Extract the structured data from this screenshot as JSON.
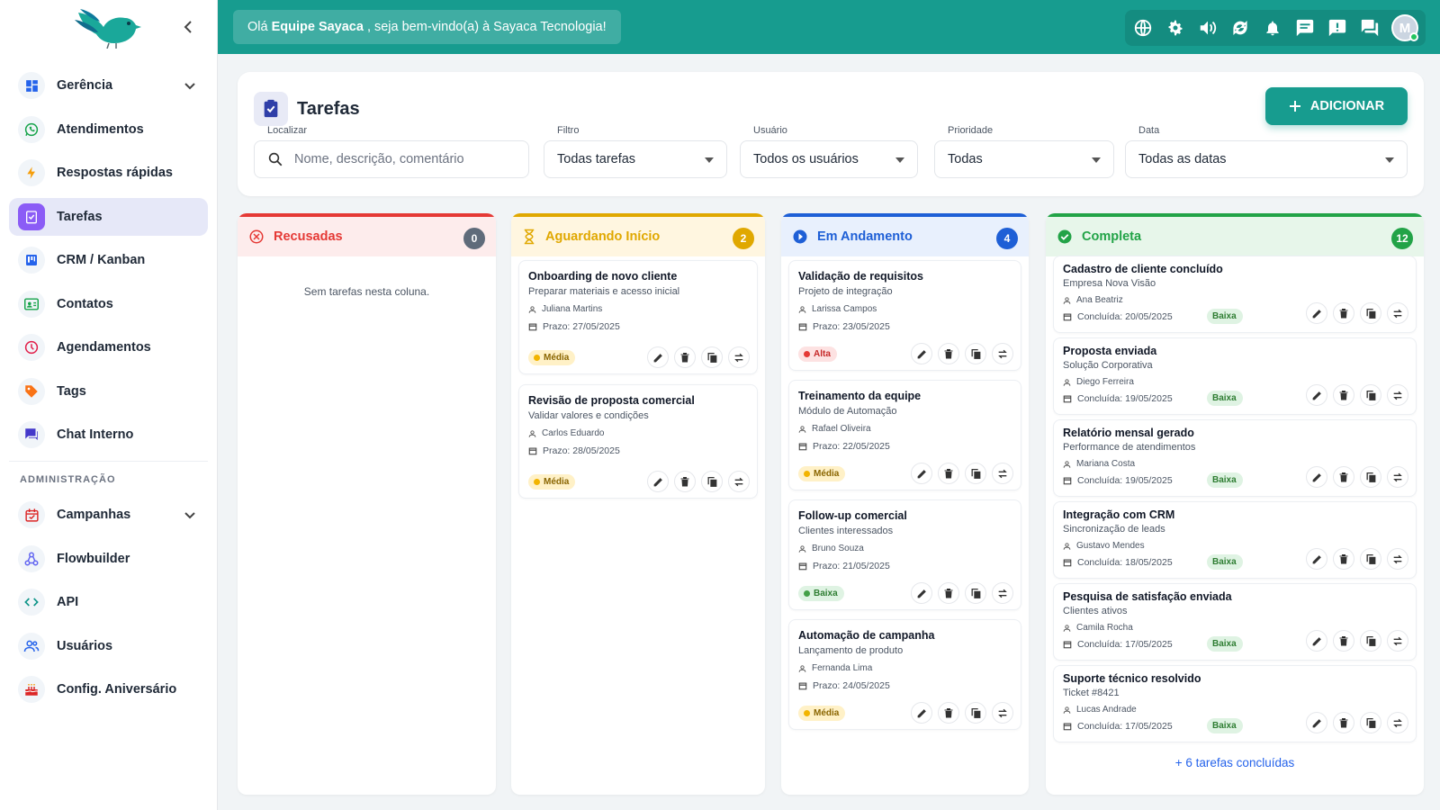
{
  "app": {
    "colors": {
      "primary": "#179c8f",
      "sidebar_active": "#e6e8f8"
    }
  },
  "sidebar": {
    "items": [
      {
        "label": "Gerência",
        "icon": "dashboard-icon",
        "color": "#2563eb",
        "chevron": true
      },
      {
        "label": "Atendimentos",
        "icon": "whatsapp-icon",
        "color": "#16a34a"
      },
      {
        "label": "Respostas rápidas",
        "icon": "bolt-icon",
        "color": "#f59e0b"
      },
      {
        "label": "Tarefas",
        "icon": "task-icon",
        "color": "#ffffff",
        "active": true
      },
      {
        "label": "CRM / Kanban",
        "icon": "kanban-icon",
        "color": "#2563eb"
      },
      {
        "label": "Contatos",
        "icon": "contacts-icon",
        "color": "#16a34a"
      },
      {
        "label": "Agendamentos",
        "icon": "clock-icon",
        "color": "#e11d48"
      },
      {
        "label": "Tags",
        "icon": "tag-icon",
        "color": "#f97316"
      },
      {
        "label": "Chat Interno",
        "icon": "chat-icon",
        "color": "#4338ca"
      }
    ],
    "admin_title": "ADMINISTRAÇÃO",
    "admin_items": [
      {
        "label": "Campanhas",
        "icon": "calendar-icon",
        "color": "#dc2626",
        "chevron": true
      },
      {
        "label": "Flowbuilder",
        "icon": "flow-icon",
        "color": "#6366f1"
      },
      {
        "label": "API",
        "icon": "code-icon",
        "color": "#0d9488"
      },
      {
        "label": "Usuários",
        "icon": "users-icon",
        "color": "#2563eb"
      },
      {
        "label": "Config. Aniversário",
        "icon": "cake-icon",
        "color": "#dc2626"
      }
    ]
  },
  "topbar": {
    "welcome_prefix": "Olá",
    "welcome_name": "Equipe Sayaca",
    "welcome_suffix": ", seja bem-vindo(a) à Sayaca Tecnologia!",
    "avatar_initial": "M",
    "icons": [
      "globe-icon",
      "settings-icon",
      "volume-icon",
      "refresh-icon",
      "bell-icon",
      "message-icon",
      "alert-icon",
      "forum-icon"
    ]
  },
  "page": {
    "title": "Tarefas",
    "add_label": "ADICIONAR",
    "filters": {
      "search": {
        "label": "Localizar",
        "placeholder": "Nome, descrição, comentário"
      },
      "filter": {
        "label": "Filtro",
        "value": "Todas tarefas"
      },
      "user": {
        "label": "Usuário",
        "value": "Todos os usuários"
      },
      "priority": {
        "label": "Prioridade",
        "value": "Todas"
      },
      "date": {
        "label": "Data",
        "value": "Todas as datas"
      }
    }
  },
  "columns": [
    {
      "title": "Recusadas",
      "count": "0",
      "color": "#e53935",
      "bg": "#fdecec",
      "icon": "cancel-icon",
      "empty_text": "Sem tarefas nesta coluna.",
      "cards": []
    },
    {
      "title": "Aguardando Início",
      "count": "2",
      "color": "#e0a800",
      "bg": "#fff6e0",
      "icon": "hourglass-icon",
      "cards": [
        {
          "title": "Onboarding de novo cliente",
          "subtitle": "Preparar materiais e acesso inicial",
          "user": "Juliana Martins",
          "date": "Prazo: 27/05/2025",
          "priority": "Média"
        },
        {
          "title": "Revisão de proposta comercial",
          "subtitle": "Validar valores e condições",
          "user": "Carlos Eduardo",
          "date": "Prazo: 28/05/2025",
          "priority": "Média"
        }
      ]
    },
    {
      "title": "Em Andamento",
      "count": "4",
      "color": "#1e5fd6",
      "bg": "#e8f0fd",
      "icon": "play-icon",
      "cards": [
        {
          "title": "Validação de requisitos",
          "subtitle": "Projeto de integração",
          "user": "Larissa Campos",
          "date": "Prazo: 23/05/2025",
          "priority": "Alta"
        },
        {
          "title": "Treinamento da equipe",
          "subtitle": "Módulo de Automação",
          "user": "Rafael Oliveira",
          "date": "Prazo: 22/05/2025",
          "priority": "Média"
        },
        {
          "title": "Follow-up comercial",
          "subtitle": "Clientes interessados",
          "user": "Bruno Souza",
          "date": "Prazo: 21/05/2025",
          "priority": "Baixa"
        },
        {
          "title": "Automação de campanha",
          "subtitle": "Lançamento de produto",
          "user": "Fernanda Lima",
          "date": "Prazo: 24/05/2025",
          "priority": "Média"
        }
      ]
    },
    {
      "title": "Completa",
      "count": "12",
      "color": "#22a347",
      "bg": "#e7f6ea",
      "icon": "check-circle-icon",
      "more_text": "+ 6 tarefas concluídas",
      "cards": [
        {
          "title": "Cadastro de cliente concluído",
          "subtitle": "Empresa Nova Visão",
          "user": "Ana Beatriz",
          "date": "Concluída: 20/05/2025",
          "priority": "Baixa"
        },
        {
          "title": "Proposta enviada",
          "subtitle": "Solução Corporativa",
          "user": "Diego Ferreira",
          "date": "Concluída: 19/05/2025",
          "priority": "Baixa"
        },
        {
          "title": "Relatório mensal gerado",
          "subtitle": "Performance de atendimentos",
          "user": "Mariana Costa",
          "date": "Concluída: 19/05/2025",
          "priority": "Baixa"
        },
        {
          "title": "Integração com CRM",
          "subtitle": "Sincronização de leads",
          "user": "Gustavo Mendes",
          "date": "Concluída: 18/05/2025",
          "priority": "Baixa"
        },
        {
          "title": "Pesquisa de satisfação enviada",
          "subtitle": "Clientes ativos",
          "user": "Camila Rocha",
          "date": "Concluída: 17/05/2025",
          "priority": "Baixa"
        },
        {
          "title": "Suporte técnico resolvido",
          "subtitle": "Ticket #8421",
          "user": "Lucas Andrade",
          "date": "Concluída: 17/05/2025",
          "priority": "Baixa"
        }
      ]
    }
  ],
  "priority_styles": {
    "Alta": {
      "bg": "#fde2e2",
      "fg": "#c62828",
      "dot": "#e53935"
    },
    "Média": {
      "bg": "#fff1c7",
      "fg": "#8a6500",
      "dot": "#f2b400"
    },
    "Baixa": {
      "bg": "#dff3e3",
      "fg": "#2e7d32",
      "dot": "#43a047"
    }
  }
}
